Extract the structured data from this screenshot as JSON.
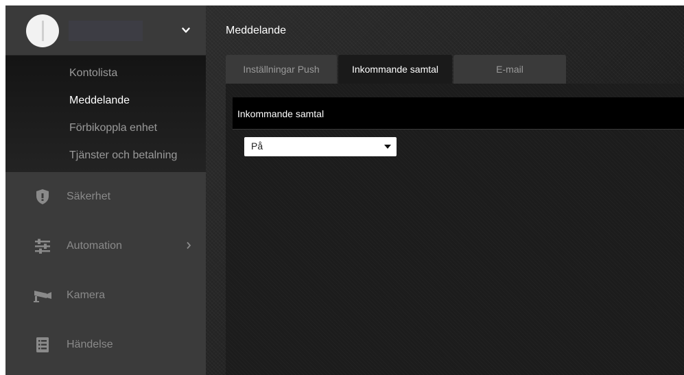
{
  "sidebar": {
    "submenu": [
      {
        "label": "Kontolista"
      },
      {
        "label": "Meddelande"
      },
      {
        "label": "Förbikoppla enhet"
      },
      {
        "label": "Tjänster och betalning"
      }
    ],
    "nav": [
      {
        "label": "Säkerhet",
        "icon": "shield-icon"
      },
      {
        "label": "Automation",
        "icon": "sliders-icon"
      },
      {
        "label": "Kamera",
        "icon": "camera-icon"
      },
      {
        "label": "Händelse",
        "icon": "list-icon"
      }
    ]
  },
  "main": {
    "title": "Meddelande",
    "tabs": [
      {
        "label": "Inställningar Push"
      },
      {
        "label": "Inkommande samtal"
      },
      {
        "label": "E-mail"
      }
    ],
    "section_title": "Inkommande samtal",
    "select": {
      "value": "På"
    }
  },
  "colors": {
    "sidebar_bg": "#3b3b3b",
    "active_text": "#ffffff",
    "inactive_text": "#9a9a9a"
  }
}
